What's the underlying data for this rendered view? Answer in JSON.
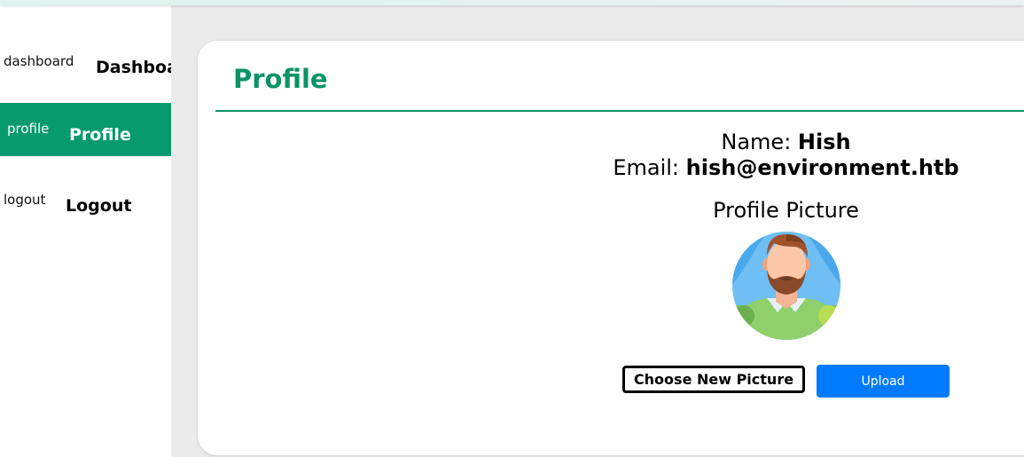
{
  "sidebar": {
    "items": [
      {
        "alt": "dashboard",
        "label": "Dashboard",
        "active": false
      },
      {
        "alt": "profile",
        "label": "Profile",
        "active": true
      },
      {
        "alt": "logout",
        "label": "Logout",
        "active": false
      }
    ]
  },
  "profile": {
    "title": "Profile",
    "name_label": "Name:",
    "name_value": "Hish",
    "email_label": "Email:",
    "email_value": "hish@environment.htb",
    "picture_heading": "Profile Picture",
    "choose_label": "Choose New Picture",
    "upload_label": "Upload"
  },
  "colors": {
    "accent": "#069a6c",
    "title": "#0a9367",
    "upload_button": "#007bff"
  },
  "icons": {
    "avatar": "bearded-man-avatar"
  }
}
